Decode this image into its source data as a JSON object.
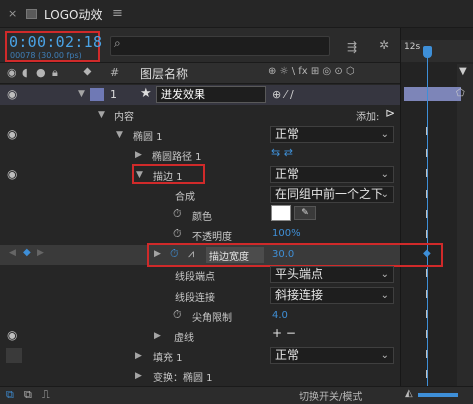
{
  "tab": {
    "title": "LOGO动效",
    "close_glyph": "×",
    "menu_glyph": "≡"
  },
  "timecode": {
    "value": "0:00:02:18",
    "fps": "00078 (30.00 fps)"
  },
  "search": {
    "placeholder": ""
  },
  "ruler": {
    "label": "12s"
  },
  "header": {
    "col_num": "#",
    "col_name": "图层名称",
    "col_switch_icons": "⊕ ☼ \\ fx ⊞ ◎ ⊙ ⬡"
  },
  "layer": {
    "index": "1",
    "name": "迸发效果",
    "star": "★"
  },
  "rows": {
    "contents": "内容",
    "add_label": "添加:",
    "ellipse1": "椭圆 1",
    "ellipse1_mode": "正常",
    "ellipse_path": "椭圆路径 1",
    "stroke1": "描边 1",
    "stroke1_mode": "正常",
    "composite": "合成",
    "composite_value": "在同组中前一个之下",
    "color": "颜色",
    "opacity": "不透明度",
    "opacity_value": "100%",
    "stroke_width": "描边宽度",
    "stroke_width_value": "30.0",
    "line_cap": "线段端点",
    "line_cap_value": "平头端点",
    "line_join": "线段连接",
    "line_join_value": "斜接连接",
    "miter_limit": "尖角限制",
    "miter_limit_value": "4.0",
    "dashes": "虚线",
    "dashes_add": "+ −",
    "fill1": "填充 1",
    "fill1_mode": "正常",
    "transform": "变换：椭圆 1"
  },
  "bottom": {
    "toggle_label": "切换开关/模式"
  },
  "colors": {
    "accent_blue": "#3f8fd6",
    "highlight_red": "#d02a2a",
    "work_area": "#7d85b8",
    "panel_bg": "#262626"
  }
}
